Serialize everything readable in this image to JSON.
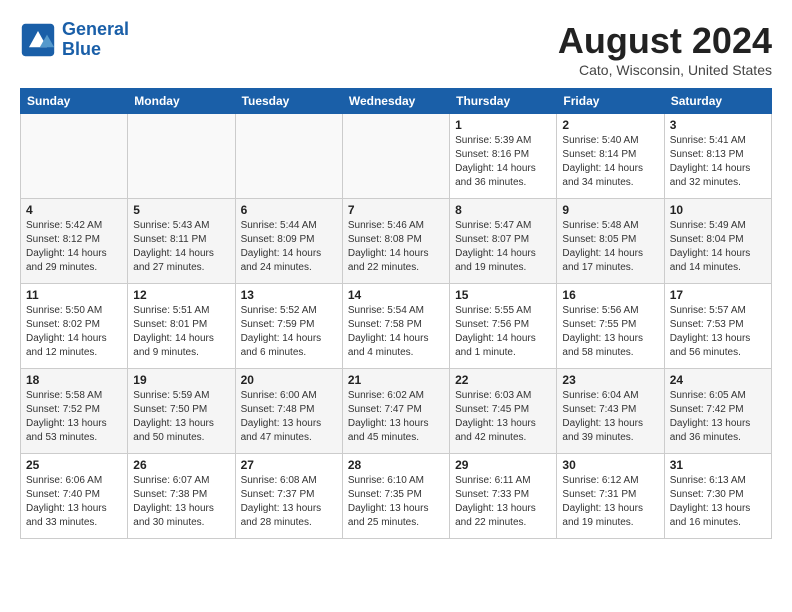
{
  "header": {
    "logo_line1": "General",
    "logo_line2": "Blue",
    "month_year": "August 2024",
    "location": "Cato, Wisconsin, United States"
  },
  "weekdays": [
    "Sunday",
    "Monday",
    "Tuesday",
    "Wednesday",
    "Thursday",
    "Friday",
    "Saturday"
  ],
  "weeks": [
    [
      {
        "day": "",
        "info": ""
      },
      {
        "day": "",
        "info": ""
      },
      {
        "day": "",
        "info": ""
      },
      {
        "day": "",
        "info": ""
      },
      {
        "day": "1",
        "info": "Sunrise: 5:39 AM\nSunset: 8:16 PM\nDaylight: 14 hours\nand 36 minutes."
      },
      {
        "day": "2",
        "info": "Sunrise: 5:40 AM\nSunset: 8:14 PM\nDaylight: 14 hours\nand 34 minutes."
      },
      {
        "day": "3",
        "info": "Sunrise: 5:41 AM\nSunset: 8:13 PM\nDaylight: 14 hours\nand 32 minutes."
      }
    ],
    [
      {
        "day": "4",
        "info": "Sunrise: 5:42 AM\nSunset: 8:12 PM\nDaylight: 14 hours\nand 29 minutes."
      },
      {
        "day": "5",
        "info": "Sunrise: 5:43 AM\nSunset: 8:11 PM\nDaylight: 14 hours\nand 27 minutes."
      },
      {
        "day": "6",
        "info": "Sunrise: 5:44 AM\nSunset: 8:09 PM\nDaylight: 14 hours\nand 24 minutes."
      },
      {
        "day": "7",
        "info": "Sunrise: 5:46 AM\nSunset: 8:08 PM\nDaylight: 14 hours\nand 22 minutes."
      },
      {
        "day": "8",
        "info": "Sunrise: 5:47 AM\nSunset: 8:07 PM\nDaylight: 14 hours\nand 19 minutes."
      },
      {
        "day": "9",
        "info": "Sunrise: 5:48 AM\nSunset: 8:05 PM\nDaylight: 14 hours\nand 17 minutes."
      },
      {
        "day": "10",
        "info": "Sunrise: 5:49 AM\nSunset: 8:04 PM\nDaylight: 14 hours\nand 14 minutes."
      }
    ],
    [
      {
        "day": "11",
        "info": "Sunrise: 5:50 AM\nSunset: 8:02 PM\nDaylight: 14 hours\nand 12 minutes."
      },
      {
        "day": "12",
        "info": "Sunrise: 5:51 AM\nSunset: 8:01 PM\nDaylight: 14 hours\nand 9 minutes."
      },
      {
        "day": "13",
        "info": "Sunrise: 5:52 AM\nSunset: 7:59 PM\nDaylight: 14 hours\nand 6 minutes."
      },
      {
        "day": "14",
        "info": "Sunrise: 5:54 AM\nSunset: 7:58 PM\nDaylight: 14 hours\nand 4 minutes."
      },
      {
        "day": "15",
        "info": "Sunrise: 5:55 AM\nSunset: 7:56 PM\nDaylight: 14 hours\nand 1 minute."
      },
      {
        "day": "16",
        "info": "Sunrise: 5:56 AM\nSunset: 7:55 PM\nDaylight: 13 hours\nand 58 minutes."
      },
      {
        "day": "17",
        "info": "Sunrise: 5:57 AM\nSunset: 7:53 PM\nDaylight: 13 hours\nand 56 minutes."
      }
    ],
    [
      {
        "day": "18",
        "info": "Sunrise: 5:58 AM\nSunset: 7:52 PM\nDaylight: 13 hours\nand 53 minutes."
      },
      {
        "day": "19",
        "info": "Sunrise: 5:59 AM\nSunset: 7:50 PM\nDaylight: 13 hours\nand 50 minutes."
      },
      {
        "day": "20",
        "info": "Sunrise: 6:00 AM\nSunset: 7:48 PM\nDaylight: 13 hours\nand 47 minutes."
      },
      {
        "day": "21",
        "info": "Sunrise: 6:02 AM\nSunset: 7:47 PM\nDaylight: 13 hours\nand 45 minutes."
      },
      {
        "day": "22",
        "info": "Sunrise: 6:03 AM\nSunset: 7:45 PM\nDaylight: 13 hours\nand 42 minutes."
      },
      {
        "day": "23",
        "info": "Sunrise: 6:04 AM\nSunset: 7:43 PM\nDaylight: 13 hours\nand 39 minutes."
      },
      {
        "day": "24",
        "info": "Sunrise: 6:05 AM\nSunset: 7:42 PM\nDaylight: 13 hours\nand 36 minutes."
      }
    ],
    [
      {
        "day": "25",
        "info": "Sunrise: 6:06 AM\nSunset: 7:40 PM\nDaylight: 13 hours\nand 33 minutes."
      },
      {
        "day": "26",
        "info": "Sunrise: 6:07 AM\nSunset: 7:38 PM\nDaylight: 13 hours\nand 30 minutes."
      },
      {
        "day": "27",
        "info": "Sunrise: 6:08 AM\nSunset: 7:37 PM\nDaylight: 13 hours\nand 28 minutes."
      },
      {
        "day": "28",
        "info": "Sunrise: 6:10 AM\nSunset: 7:35 PM\nDaylight: 13 hours\nand 25 minutes."
      },
      {
        "day": "29",
        "info": "Sunrise: 6:11 AM\nSunset: 7:33 PM\nDaylight: 13 hours\nand 22 minutes."
      },
      {
        "day": "30",
        "info": "Sunrise: 6:12 AM\nSunset: 7:31 PM\nDaylight: 13 hours\nand 19 minutes."
      },
      {
        "day": "31",
        "info": "Sunrise: 6:13 AM\nSunset: 7:30 PM\nDaylight: 13 hours\nand 16 minutes."
      }
    ]
  ]
}
